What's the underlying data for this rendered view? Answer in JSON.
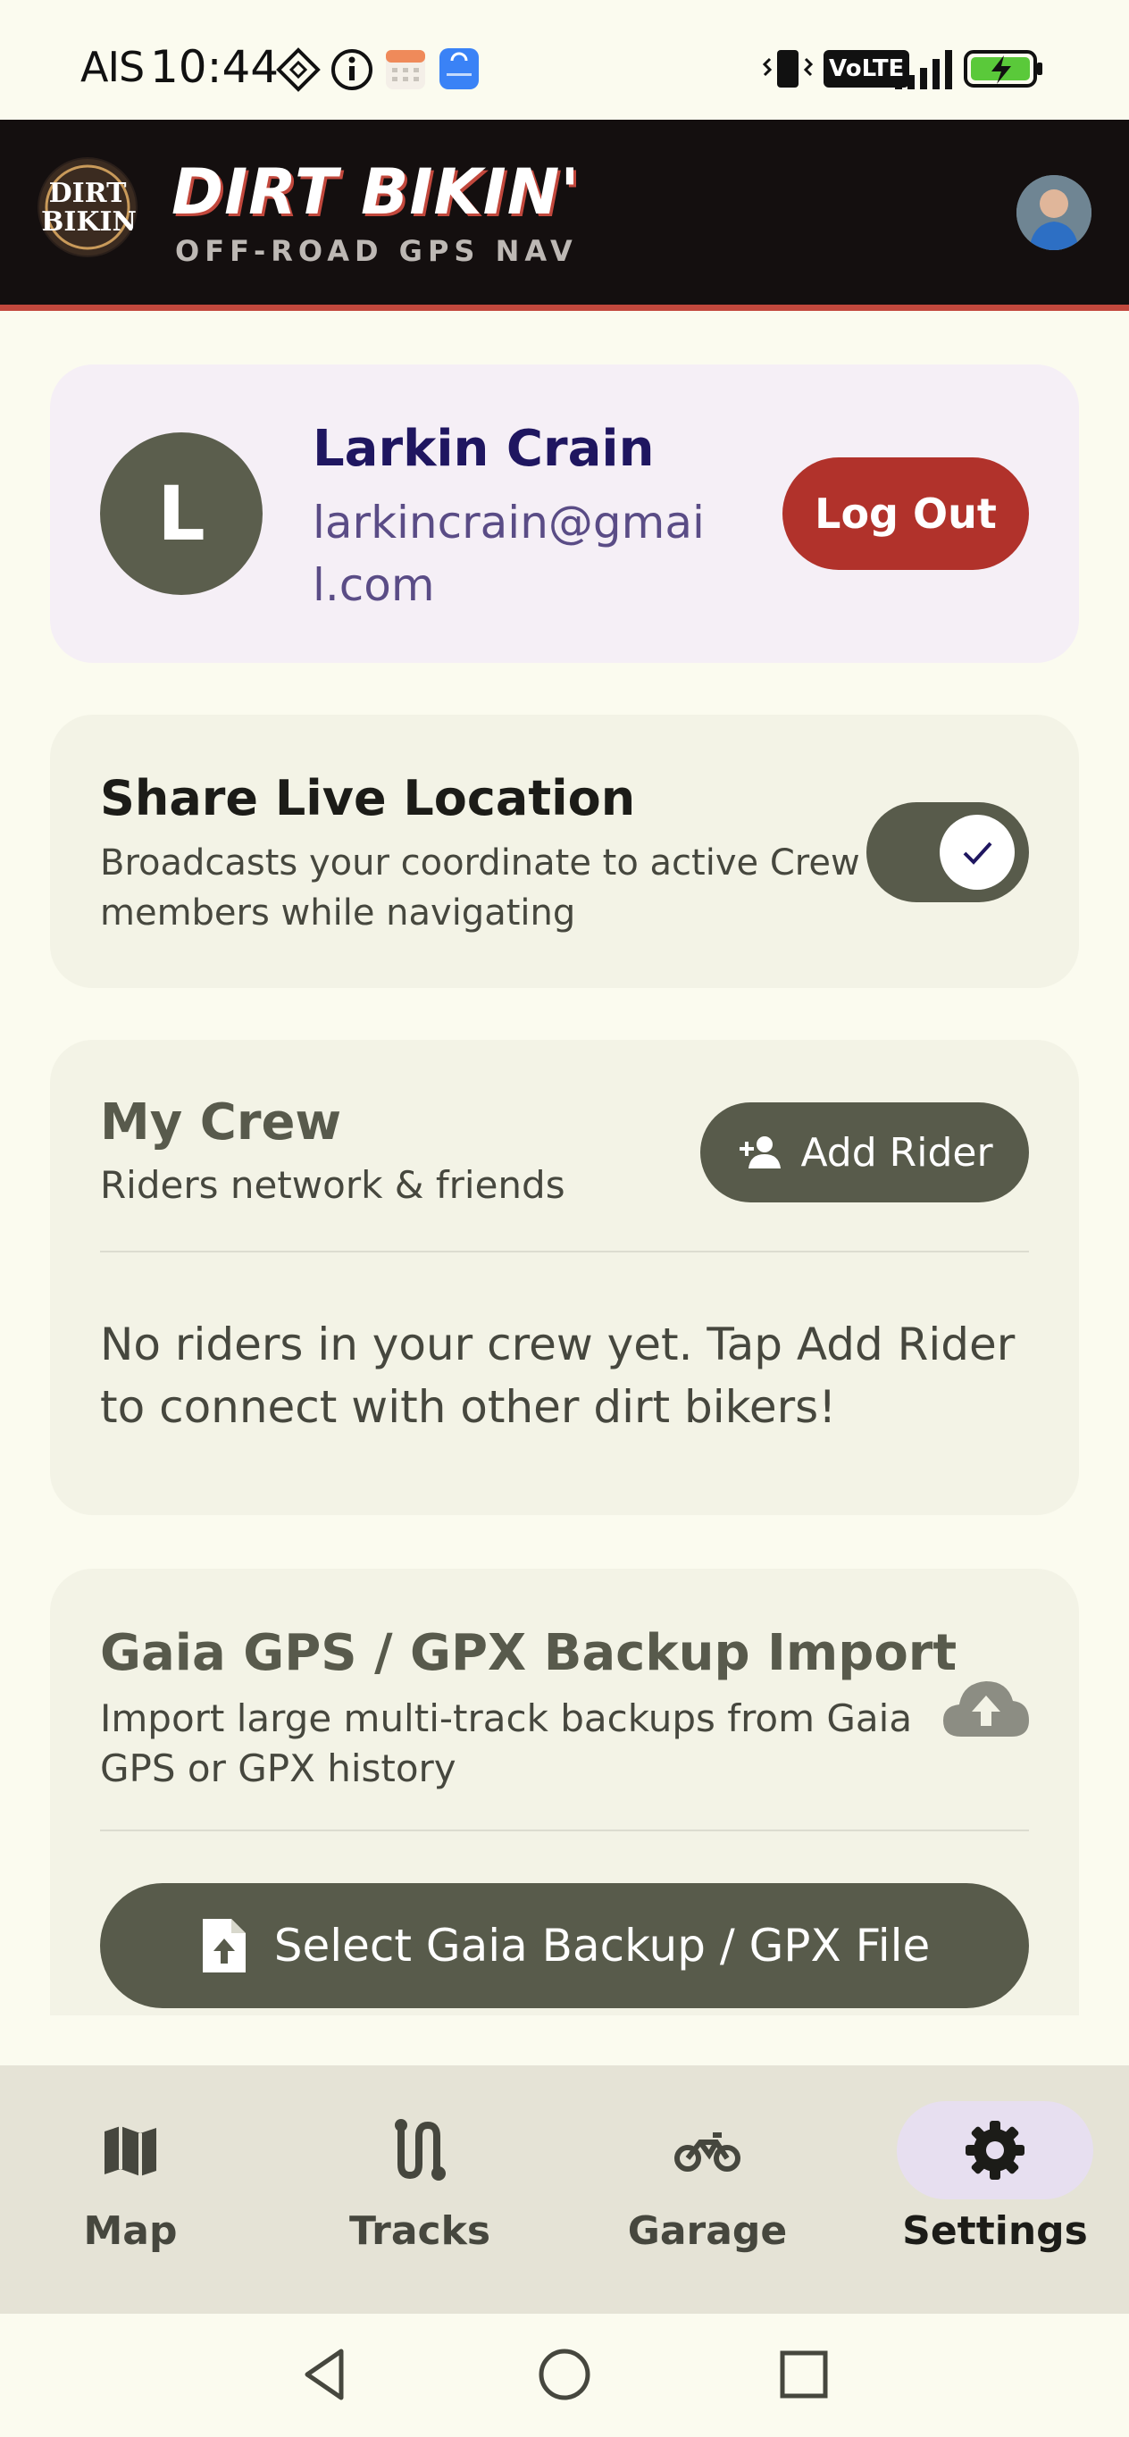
{
  "status_bar": {
    "carrier": "AIS",
    "time": "10:44",
    "network_badge": "VoLTE"
  },
  "header": {
    "logo_text_line1": "DIRT",
    "logo_text_line2": "BIKIN",
    "brand_title": "DIRT BIKIN'",
    "tagline": "OFF-ROAD GPS NAV"
  },
  "user": {
    "initial": "L",
    "name": "Larkin Crain",
    "email": "larkincrain@gmail.com",
    "logout_label": "Log Out"
  },
  "share_location": {
    "title": "Share Live Location",
    "description": "Broadcasts your coordinate to active Crew members while navigating",
    "enabled": true
  },
  "crew": {
    "title": "My Crew",
    "subtitle": "Riders network & friends",
    "add_label": "Add Rider",
    "empty_message": "No riders in your crew yet. Tap Add Rider to connect with other dirt bikers!"
  },
  "gaia_import": {
    "title": "Gaia GPS / GPX Backup Import",
    "description": "Import large multi-track backups from Gaia GPS or GPX history",
    "select_label": "Select Gaia Backup / GPX File"
  },
  "bottom_nav": {
    "items": [
      {
        "label": "Map",
        "icon": "map-icon"
      },
      {
        "label": "Tracks",
        "icon": "route-icon"
      },
      {
        "label": "Garage",
        "icon": "motorcycle-icon"
      },
      {
        "label": "Settings",
        "icon": "gear-icon"
      }
    ],
    "active": "Settings"
  },
  "colors": {
    "header_bg": "#140f0f",
    "accent_red": "#b1322b",
    "olive": "#585b4b",
    "user_card_bg": "#f5eff6",
    "nav_active_pill": "#e7dff0"
  }
}
